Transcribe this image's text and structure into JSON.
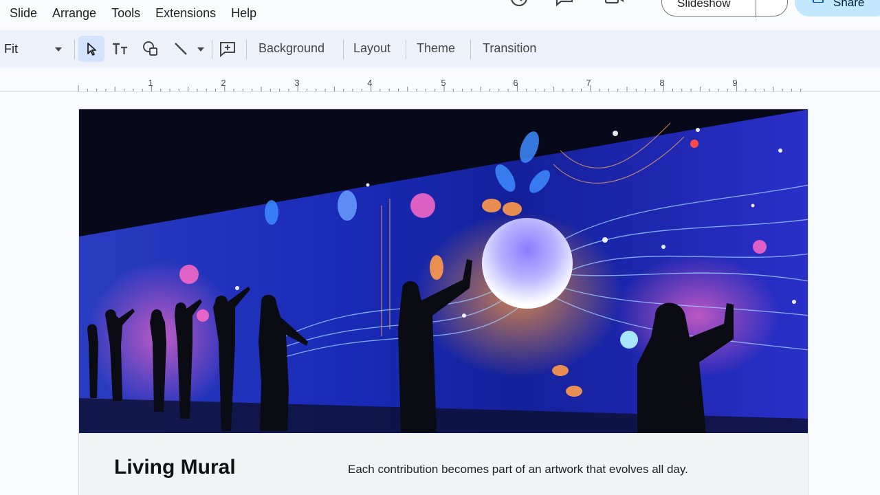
{
  "menu": {
    "items": [
      {
        "label": "Slide"
      },
      {
        "label": "Arrange"
      },
      {
        "label": "Tools"
      },
      {
        "label": "Extensions"
      },
      {
        "label": "Help"
      }
    ]
  },
  "header": {
    "slideshow_label": "Slideshow",
    "share_label": "Share",
    "icons": [
      "history-icon",
      "comment-icon",
      "meet-icon"
    ]
  },
  "toolbar": {
    "zoom_value": "Fit",
    "tools": [
      "select-icon",
      "text-box-icon",
      "shapes-icon",
      "line-icon",
      "new-comment-icon"
    ],
    "background_label": "Background",
    "layout_label": "Layout",
    "theme_label": "Theme",
    "transition_label": "Transition"
  },
  "ruler": {
    "numbers": [
      "1",
      "2",
      "3",
      "4",
      "5",
      "6",
      "7",
      "8",
      "9"
    ]
  },
  "slide": {
    "title": "Living Mural",
    "caption": "Each contribution becomes part of an artwork that evolves all day."
  },
  "colors": {
    "toolbar_bg": "#edf2fa",
    "active_tool": "#d3e3fd",
    "share_bg": "#c2e7ff"
  }
}
